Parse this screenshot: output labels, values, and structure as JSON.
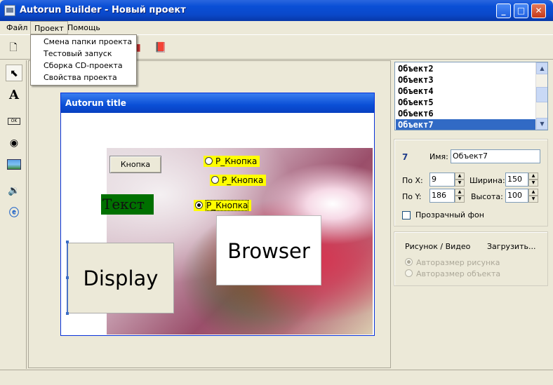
{
  "window": {
    "title": "Autorun Builder - Новый проект"
  },
  "menu": {
    "items": [
      "Файл",
      "Проект",
      "Помощь"
    ]
  },
  "project_menu": {
    "items": [
      "Смена папки проекта",
      "Тестовый запуск",
      "Сборка CD-проекта",
      "Свойства проекта"
    ]
  },
  "toolbar": {
    "icons": [
      "new-file-icon",
      "test-run-icon",
      "help-book-icon"
    ]
  },
  "tools": [
    "pointer-icon",
    "text-tool-icon",
    "button-tool-icon",
    "radio-tool-icon",
    "image-tool-icon",
    "sound-tool-icon",
    "browser-tool-icon"
  ],
  "canvas": {
    "window_title": "Autorun title",
    "button_label": "Кнопка",
    "radios": [
      "Р_Кнопка",
      "Р_Кнопка",
      "Р_Кнопка"
    ],
    "text_label": "Текст",
    "browser_label": "Browser",
    "display_label": "Display"
  },
  "objects": {
    "items": [
      "Объект2",
      "Объект3",
      "Объект4",
      "Объект5",
      "Объект6",
      "Объект7"
    ],
    "selected": "Объект7"
  },
  "props": {
    "index": "7",
    "name_label": "Имя:",
    "name_value": "Объект7",
    "x_label": "По X:",
    "x_value": "9",
    "y_label": "По Y:",
    "y_value": "186",
    "width_label": "Ширина:",
    "width_value": "150",
    "height_label": "Высота:",
    "height_value": "100",
    "transparent_label": "Прозрачный фон"
  },
  "media": {
    "label": "Рисунок / Видео",
    "load_label": "Загрузить...",
    "opt1": "Авторазмер рисунка",
    "opt2": "Авторазмер объекта"
  }
}
